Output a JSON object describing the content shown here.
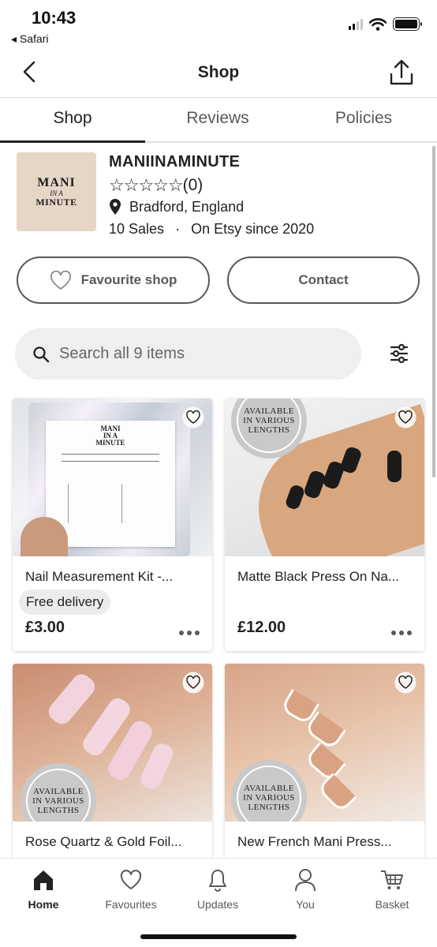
{
  "status_bar": {
    "time": "10:43",
    "back_app": "Safari"
  },
  "header": {
    "title": "Shop"
  },
  "tabs": [
    {
      "label": "Shop",
      "active": true
    },
    {
      "label": "Reviews",
      "active": false
    },
    {
      "label": "Policies",
      "active": false
    }
  ],
  "shop": {
    "logo_text": {
      "line1": "MANI",
      "line2": "IN A",
      "line3": "MINUTE"
    },
    "name": "MANIINAMINUTE",
    "rating_count": "(0)",
    "rating_stars": 0,
    "location": "Bradford, England",
    "sales": "10 Sales",
    "separator": "·",
    "since": "On Etsy since 2020"
  },
  "actions": {
    "favourite_label": "Favourite shop",
    "contact_label": "Contact"
  },
  "search": {
    "placeholder": "Search all 9 items"
  },
  "overlay_text": {
    "line1": "AVAILABLE",
    "line2": "IN VARIOUS",
    "line3": "LENGTHS"
  },
  "listings": [
    {
      "title": "Nail Measurement Kit -...",
      "badge": "Free delivery",
      "price": "£3.00"
    },
    {
      "title": "Matte Black Press On Na...",
      "badge": "",
      "price": "£12.00"
    },
    {
      "title": "Rose Quartz & Gold Foil...",
      "badge": "",
      "price": ""
    },
    {
      "title": "New French Mani Press...",
      "badge": "",
      "price": ""
    }
  ],
  "bottom_nav": [
    {
      "label": "Home",
      "icon": "home-icon",
      "active": true
    },
    {
      "label": "Favourites",
      "icon": "heart-icon",
      "active": false
    },
    {
      "label": "Updates",
      "icon": "bell-icon",
      "active": false
    },
    {
      "label": "You",
      "icon": "user-icon",
      "active": false
    },
    {
      "label": "Basket",
      "icon": "basket-icon",
      "active": false
    }
  ],
  "colors": {
    "text": "#222222",
    "muted": "#595959",
    "logo_bg": "#e6d6c6",
    "search_bg": "#efefef"
  }
}
